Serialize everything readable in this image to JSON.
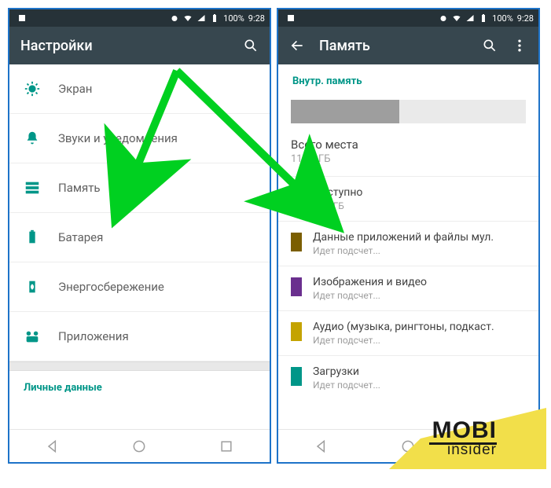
{
  "status": {
    "battery": "100%",
    "time": "9:28"
  },
  "left": {
    "title": "Настройки",
    "items": [
      {
        "label": "Экран"
      },
      {
        "label": "Звуки и уведомления"
      },
      {
        "label": "Память"
      },
      {
        "label": "Батарея"
      },
      {
        "label": "Энергосбережение"
      },
      {
        "label": "Приложения"
      }
    ],
    "section": "Личные данные"
  },
  "right": {
    "title": "Память",
    "section": "Внутр. память",
    "total": {
      "label": "Всего места",
      "value": "11,99 ГБ"
    },
    "items": [
      {
        "color": "#e0e0e0",
        "label": "Доступно",
        "sub": "6,63 ГБ"
      },
      {
        "color": "#7b5e00",
        "label": "Данные приложений и файлы мул.",
        "sub": "Идет подсчет..."
      },
      {
        "color": "#6a2f8e",
        "label": "Изображения и видео",
        "sub": "Идет подсчет..."
      },
      {
        "color": "#c4a300",
        "label": "Аудио (музыка, рингтоны, подкаст.",
        "sub": "Идет подсчет..."
      },
      {
        "color": "#009688",
        "label": "Загрузки",
        "sub": "Идет подсчет..."
      }
    ]
  },
  "logo": {
    "line1": "MOBI",
    "line2": "insider"
  },
  "colors": {
    "accent": "#009688",
    "arrow": "#00d020"
  }
}
